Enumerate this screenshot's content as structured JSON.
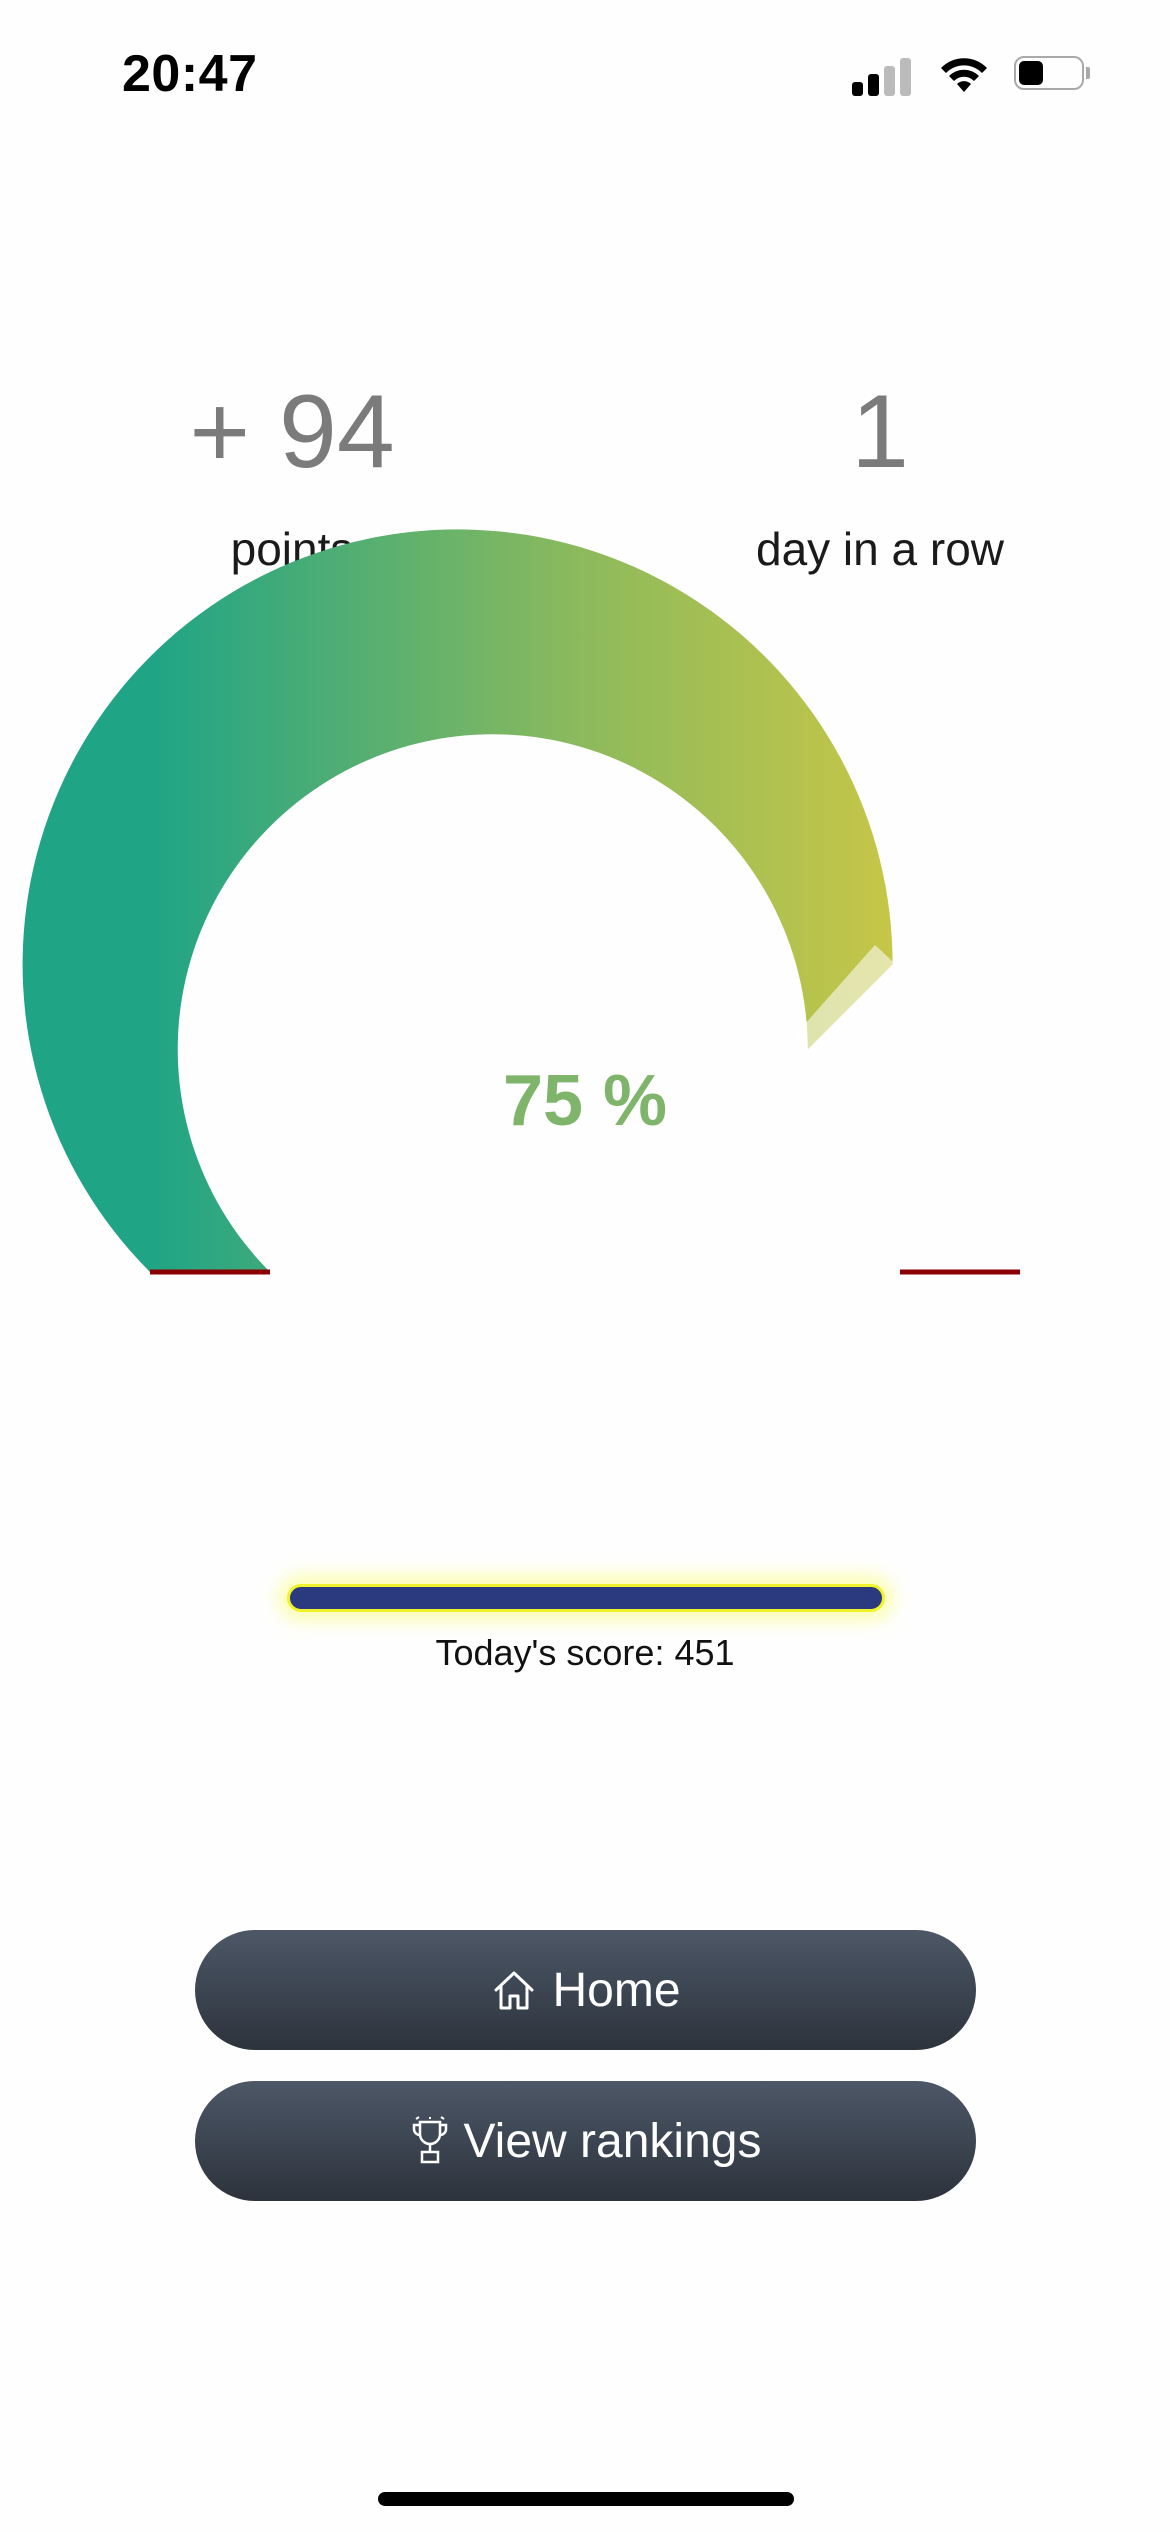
{
  "status_bar": {
    "time": "20:47",
    "signal_icon": "cellular-signal-icon",
    "wifi_icon": "wifi-icon",
    "battery_icon": "battery-icon",
    "battery_level": 0.4
  },
  "stats": {
    "points_value": "+ 94",
    "points_label": "points",
    "streak_value": "1",
    "streak_label": "day in a row"
  },
  "gauge": {
    "percent_text": "75 %",
    "value": 75,
    "colors": {
      "start": "#1fa486",
      "mid": "#8dba5c",
      "end": "#cfc844",
      "baseline": "#8b0000",
      "percent_text": "#7fb56a"
    }
  },
  "score": {
    "label": "Today's score: 451",
    "bar_color": "#2b3a7e",
    "glow_color": "#f0f22a"
  },
  "buttons": {
    "home_label": "Home",
    "home_icon": "house-icon",
    "rankings_label": "View rankings",
    "rankings_icon": "trophy-icon"
  }
}
